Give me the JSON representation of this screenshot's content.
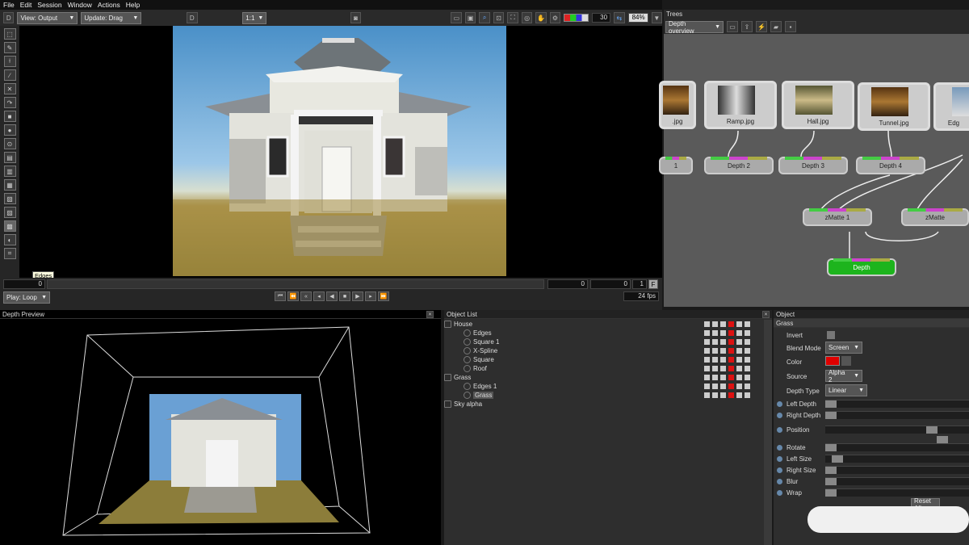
{
  "menu": [
    "File",
    "Edit",
    "Session",
    "Window",
    "Actions",
    "Help"
  ],
  "toolbar": {
    "d_label": "D",
    "view": "View: Output",
    "update": "Update: Drag",
    "d2": "D",
    "ratio": "1:1",
    "frame_value": "30",
    "zoom": "84%"
  },
  "tooltip": "Edges",
  "timeline": {
    "start": "0",
    "current": "0",
    "end": "0",
    "frame": "1",
    "f_label": "F",
    "play": "Play: Loop",
    "fps": "24",
    "fps_unit": "fps"
  },
  "trees": {
    "title": "Trees",
    "overview": "Depth overview",
    "nodes": [
      ".jpg",
      "Ramp.jpg",
      "Hall.jpg",
      "Tunnel.jpg",
      "Edg"
    ],
    "depth_nodes": [
      "1",
      "Depth 2",
      "Depth 3",
      "Depth 4"
    ],
    "zmatte": [
      "zMatte 1",
      "zMatte"
    ],
    "output": "Depth"
  },
  "preview": {
    "title": "Depth Preview"
  },
  "objects": {
    "title": "Object List",
    "items": [
      {
        "label": "House",
        "indent": 0
      },
      {
        "label": "Edges",
        "indent": 1
      },
      {
        "label": "Square 1",
        "indent": 1
      },
      {
        "label": "X-Spline",
        "indent": 1
      },
      {
        "label": "Square",
        "indent": 1
      },
      {
        "label": "Roof",
        "indent": 1
      },
      {
        "label": "Grass",
        "indent": 0
      },
      {
        "label": "Edges 1",
        "indent": 1
      },
      {
        "label": "Grass",
        "indent": 1
      },
      {
        "label": "Sky alpha",
        "indent": 0
      }
    ]
  },
  "object": {
    "title": "Object",
    "selected": "Grass",
    "invert": "Invert",
    "blend_label": "Blend Mode",
    "blend": "Screen",
    "color_label": "Color",
    "color": "#e00000",
    "source_label": "Source",
    "source": "Alpha 2",
    "depthtype_label": "Depth Type",
    "depthtype": "Linear",
    "sliders": [
      {
        "label": "Left Depth",
        "value": 0
      },
      {
        "label": "Right Depth",
        "value": 0
      },
      {
        "label": "Position",
        "value": 0.75
      },
      {
        "label": "Rotate",
        "value": 0
      },
      {
        "label": "Left Size",
        "value": 0.05
      },
      {
        "label": "Right Size",
        "value": 0
      },
      {
        "label": "Blur",
        "value": 0
      },
      {
        "label": "Wrap",
        "value": 0
      }
    ],
    "reset": "Reset All"
  }
}
